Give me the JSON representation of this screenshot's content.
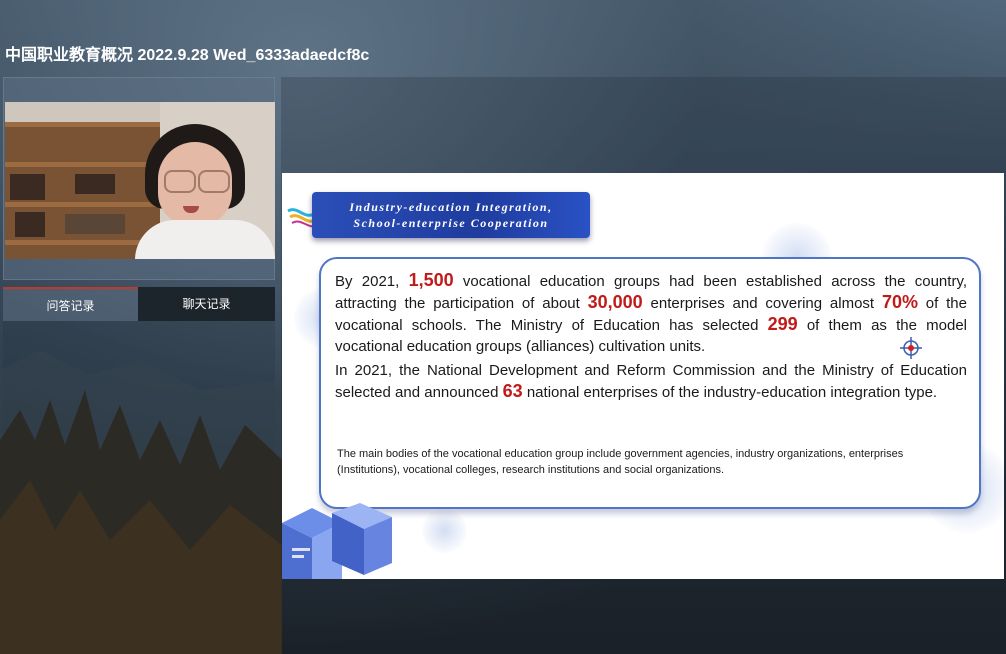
{
  "window": {
    "title": "中国职业教育概况 2022.9.28 Wed_6333adaedcf8c"
  },
  "left_panel": {
    "video_feed": {
      "label": ""
    },
    "tabs": [
      {
        "label": "问答记录",
        "active": true
      },
      {
        "label": "聊天记录",
        "active": false
      }
    ]
  },
  "slide": {
    "banner": {
      "line1": "Industry-education Integration,",
      "line2": "School-enterprise Cooperation"
    },
    "para1": {
      "t1": "By 2021, ",
      "n1": "1,500",
      "t2": " vocational education groups had been established across the country, attracting the participation of about ",
      "n2": "30,000",
      "t3": " enterprises and covering almost ",
      "n3": "70%",
      "t4": " of the vocational schools. The Ministry of Education has selected ",
      "n4": "299",
      "t5": " of them as the model vocational education groups (alliances) cultivation units."
    },
    "para2": {
      "t1": "In 2021, the National Development and Reform Commission and the Ministry of Education selected and announced ",
      "n1": "63",
      "t2": " national enterprises of the industry-education integration type."
    },
    "note": "The main bodies of the vocational education group include government agencies, industry organizations, enterprises (Institutions), vocational colleges, research institutions and social organizations."
  },
  "colors": {
    "highlight": "#c01a1a",
    "banner_blue": "#1f3c9f",
    "box_border": "#4f74c8",
    "active_tab_accent": "#c0392b"
  }
}
